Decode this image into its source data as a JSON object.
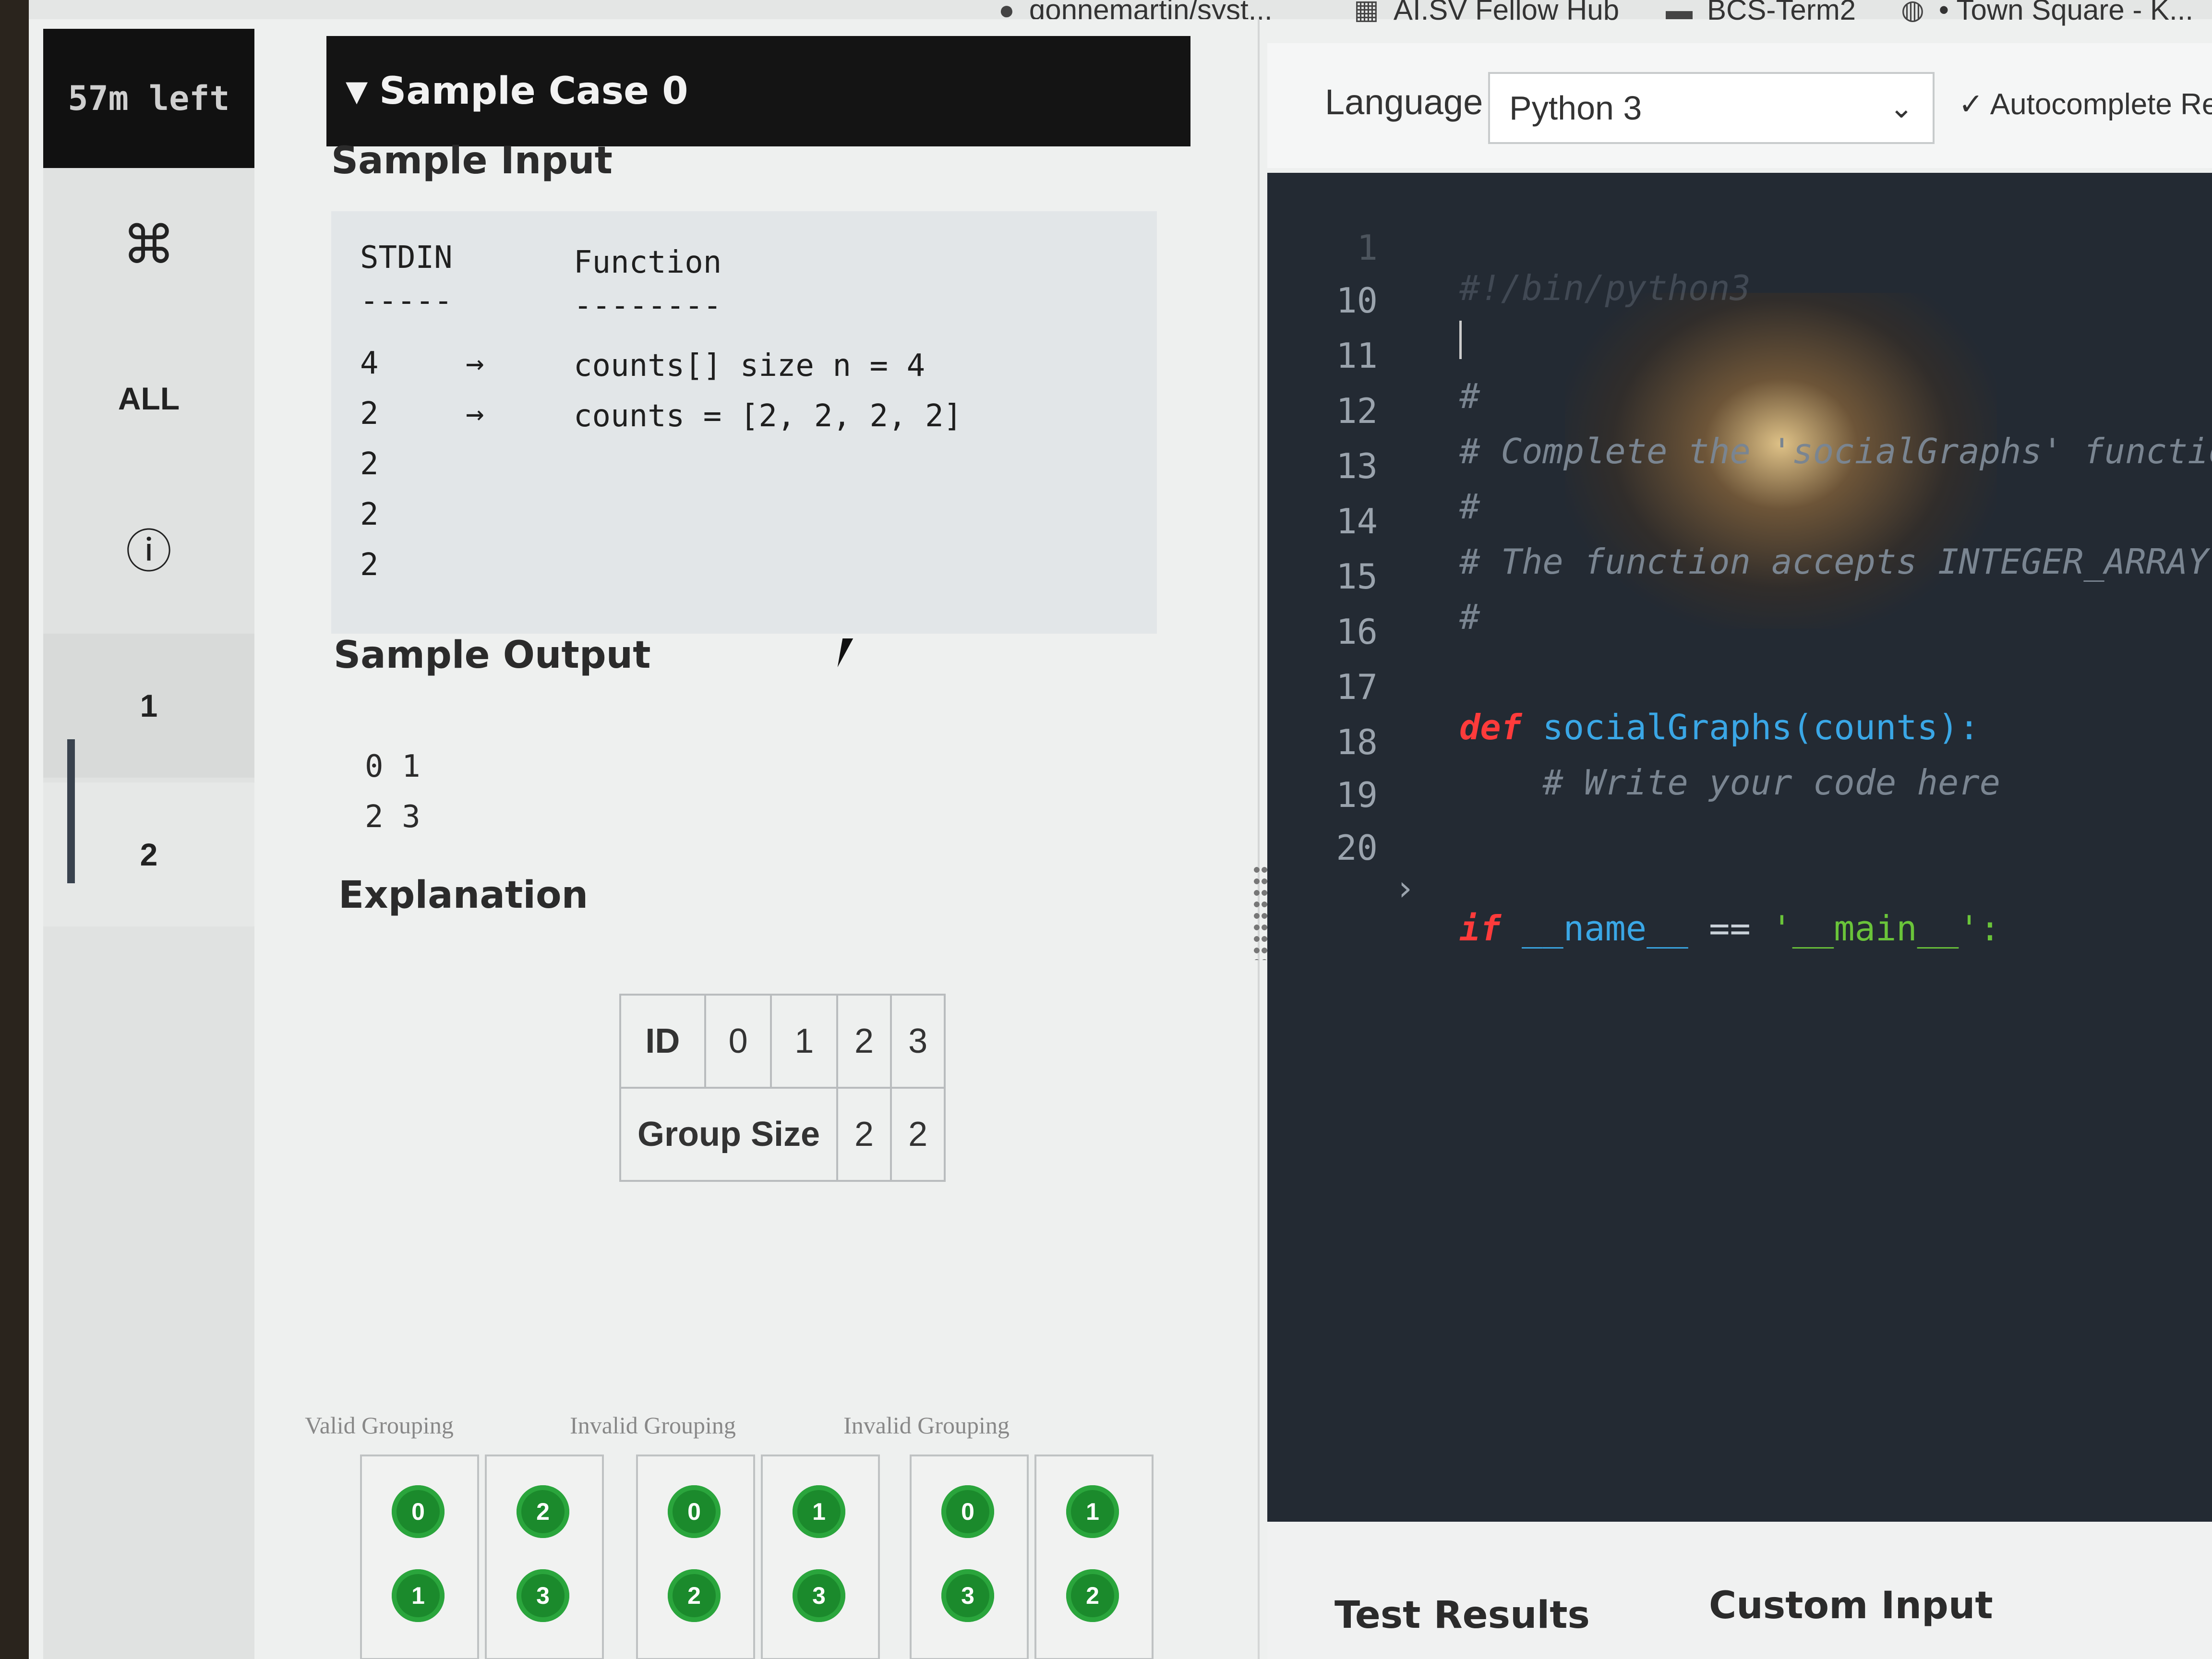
{
  "bookmarks": [
    {
      "icon": "github-icon",
      "label": "gonnemartin/syst..."
    },
    {
      "icon": "grid-icon",
      "label": "AI.SV Fellow Hub"
    },
    {
      "icon": "folder-icon",
      "label": "BCS-Term2"
    },
    {
      "icon": "globe-icon",
      "label": "• Town Square - K..."
    }
  ],
  "leftnav": {
    "timer": "57m left",
    "shortcut_icon": "⌘",
    "all_label": "ALL",
    "info_icon": "ⓘ",
    "questions": [
      "1",
      "2"
    ]
  },
  "problem": {
    "case_header": "Sample Case 0",
    "sample_input_title": "Sample Input",
    "input_headers": [
      "STDIN",
      "Function"
    ],
    "input_underlines": [
      "-----",
      "--------"
    ],
    "input_rows": [
      {
        "stdin": "4",
        "arrow": "→",
        "function": "counts[] size n = 4"
      },
      {
        "stdin": "2",
        "arrow": "→",
        "function": "counts = [2, 2, 2, 2]"
      },
      {
        "stdin": "2",
        "arrow": "",
        "function": ""
      },
      {
        "stdin": "2",
        "arrow": "",
        "function": ""
      },
      {
        "stdin": "2",
        "arrow": "",
        "function": ""
      }
    ],
    "sample_output_title": "Sample Output",
    "output_lines": [
      "0 1",
      "2 3"
    ],
    "explanation_title": "Explanation",
    "id_table": {
      "row1": [
        "ID",
        "0",
        "1",
        "2",
        "3"
      ],
      "row2_label": "Group Size",
      "row2_values": [
        "2",
        "2"
      ]
    },
    "groupings": [
      {
        "label": "Valid Grouping",
        "boxes": [
          [
            "0",
            "1"
          ],
          [
            "2",
            "3"
          ]
        ]
      },
      {
        "label": "Invalid Grouping",
        "boxes": [
          [
            "0",
            "2"
          ],
          [
            "1",
            "3"
          ]
        ]
      },
      {
        "label": "Invalid Grouping",
        "boxes": [
          [
            "0",
            "3"
          ],
          [
            "1",
            "2"
          ]
        ]
      }
    ]
  },
  "editor": {
    "language_label": "Language",
    "language_value": "Python 3",
    "autocomplete_label": "Autocomplete Re",
    "lines": [
      {
        "n": "1",
        "text": "#!/bin/python3"
      },
      {
        "n": "10",
        "text": ""
      },
      {
        "n": "11",
        "text": "#"
      },
      {
        "n": "12",
        "text": "# Complete the 'socialGraphs' function"
      },
      {
        "n": "13",
        "text": "#"
      },
      {
        "n": "14",
        "text": "# The function accepts INTEGER_ARRAY co"
      },
      {
        "n": "15",
        "text": "#"
      },
      {
        "n": "16",
        "text": ""
      },
      {
        "n": "17",
        "kw": "def ",
        "fn": "socialGraphs(counts):"
      },
      {
        "n": "18",
        "text": "    # Write your code here"
      },
      {
        "n": "19",
        "text": ""
      },
      {
        "n": "20",
        "kw": "if ",
        "fn": "__name__",
        "op": " == ",
        "st": "'__main__':"
      }
    ]
  },
  "bottom_tabs": [
    "Test Results",
    "Custom Input"
  ]
}
